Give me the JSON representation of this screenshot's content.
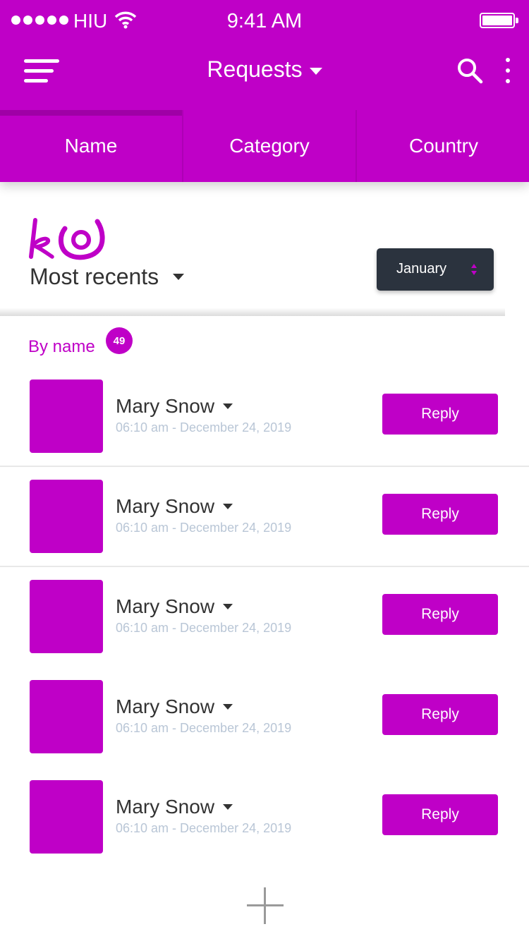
{
  "colors": {
    "accent": "#bf00c7",
    "month_button": "#2b333e",
    "date_text": "#b9c6d6"
  },
  "status_bar": {
    "carrier": "HIU",
    "time": "9:41 AM"
  },
  "app_bar": {
    "title": "Requests",
    "icons": [
      "menu-icon",
      "search-icon",
      "more-vertical-icon"
    ]
  },
  "tabs": [
    {
      "label": "Name"
    },
    {
      "label": "Category"
    },
    {
      "label": "Country"
    }
  ],
  "filters": {
    "sort_label": "Most recents",
    "month": "January"
  },
  "section": {
    "title": "By name",
    "count": "49"
  },
  "requests": [
    {
      "name": "Mary Snow",
      "date": "06:10 am - December 24, 2019",
      "action": "Reply"
    },
    {
      "name": "Mary Snow",
      "date": "06:10 am - December 24, 2019",
      "action": "Reply"
    },
    {
      "name": "Mary Snow",
      "date": "06:10 am - December 24, 2019",
      "action": "Reply"
    },
    {
      "name": "Mary Snow",
      "date": "06:10 am - December 24, 2019",
      "action": "Reply"
    },
    {
      "name": "Mary Snow",
      "date": "06:10 am - December 24, 2019",
      "action": "Reply"
    }
  ],
  "fab": {
    "icon": "plus-icon"
  }
}
